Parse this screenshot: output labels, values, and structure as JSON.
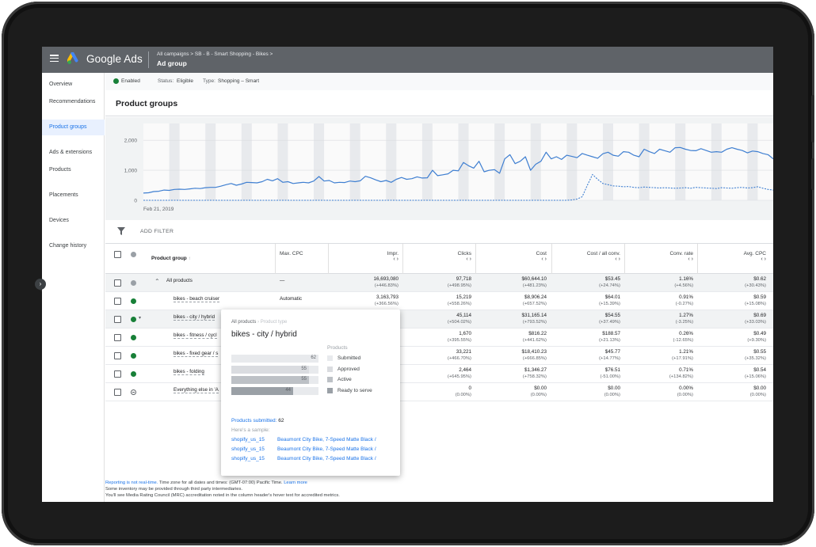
{
  "app": {
    "brand": "Google Ads"
  },
  "breadcrumb": {
    "path": "All campaigns  >  SB - B - Smart Shopping - Bikes  >",
    "title": "Ad group"
  },
  "sidebar": {
    "items": [
      {
        "label": "Overview"
      },
      {
        "label": "Recommendations"
      },
      {
        "label": "Product groups",
        "active": true
      },
      {
        "label": "Ads & extensions"
      },
      {
        "label": "Products"
      },
      {
        "label": "Placements"
      },
      {
        "label": "Devices"
      },
      {
        "label": "Change history"
      }
    ]
  },
  "status": {
    "state": "Enabled",
    "status_label": "Status:",
    "status_value": "Eligible",
    "type_label": "Type:",
    "type_value": "Shopping – Smart"
  },
  "page": {
    "title": "Product groups"
  },
  "chart_data": {
    "type": "line",
    "x_start_label": "Feb 21, 2019",
    "yticks": [
      "2,000",
      "1,000",
      "0"
    ],
    "ylim": [
      0,
      2400
    ],
    "grid": true,
    "series": [
      {
        "values": [
          240,
          250,
          290,
          300,
          340,
          330,
          360,
          370,
          360,
          380,
          400,
          390,
          420,
          430,
          430,
          470,
          520,
          560,
          500,
          540,
          600,
          590,
          580,
          620,
          700,
          650,
          720,
          600,
          620,
          560,
          580,
          600,
          580,
          640,
          790,
          640,
          660,
          580,
          600,
          590,
          640,
          620,
          650,
          800,
          750,
          680,
          620,
          660,
          600,
          700,
          760,
          700,
          720,
          780,
          740,
          750,
          1000,
          820,
          850,
          880,
          1000,
          980,
          1260,
          1150,
          1070,
          1300,
          950,
          1000,
          1020,
          900,
          1380,
          1520,
          1220,
          1300,
          1450,
          1000,
          1200,
          1300,
          1600,
          1380,
          1450,
          1360,
          1500,
          1460,
          1420,
          1560,
          1500,
          1450,
          1400,
          1550,
          1600,
          1500,
          1470,
          1620,
          1600,
          1500,
          1450,
          1700,
          1620,
          1560,
          1700,
          1650,
          1600,
          1750,
          1760,
          1700,
          1660,
          1650,
          1720,
          1660,
          1600,
          1620,
          1600,
          1700,
          1750,
          1700,
          1660,
          1580,
          1640,
          1620,
          1560,
          1520,
          1380
        ]
      },
      {
        "values": [
          0,
          0,
          0,
          0,
          0,
          0,
          0,
          0,
          0,
          0,
          0,
          0,
          0,
          0,
          0,
          0,
          0,
          0,
          0,
          0,
          0,
          0,
          0,
          0,
          0,
          0,
          0,
          0,
          0,
          0,
          0,
          0,
          0,
          0,
          0,
          0,
          0,
          0,
          0,
          0,
          0,
          0,
          0,
          0,
          0,
          0,
          0,
          0,
          0,
          0,
          0,
          0,
          0,
          0,
          0,
          0,
          0,
          0,
          0,
          0,
          0,
          0,
          0,
          0,
          0,
          0,
          0,
          0,
          0,
          0,
          0,
          0,
          0,
          0,
          0,
          0,
          0,
          0,
          0,
          0,
          0,
          0,
          0,
          10,
          40,
          120,
          500,
          860,
          700,
          560,
          520,
          480,
          470,
          450,
          460,
          430,
          420,
          440,
          430,
          420,
          410,
          420,
          410,
          400,
          410,
          420,
          400,
          430,
          420,
          410,
          400,
          390,
          420,
          410,
          400,
          420,
          430,
          410,
          420,
          450,
          400,
          360,
          340,
          350
        ]
      }
    ]
  },
  "filter": {
    "label": "ADD FILTER"
  },
  "table": {
    "headers": {
      "group": "Product group",
      "cpc": "Max. CPC",
      "impr": "Impr.",
      "clicks": "Clicks",
      "cost": "Cost",
      "cpa": "Cost / all conv.",
      "rate": "Conv. rate",
      "avgcpc": "Avg. CPC"
    },
    "rows": [
      {
        "name": "All products",
        "cpc": "—",
        "impr": "16,693,080",
        "impr_d": "(+446.83%)",
        "clicks": "97,718",
        "clicks_d": "(+498.95%)",
        "cost": "$60,644.10",
        "cost_d": "(+481.23%)",
        "cpa": "$53.45",
        "cpa_d": "(+24.74%)",
        "rate": "1.16%",
        "rate_d": "(+4.56%)",
        "avgcpc": "$0.62",
        "avgcpc_d": "(+30.43%)"
      },
      {
        "name": "bikes - beach cruiser",
        "cpc": "Automatic",
        "impr": "3,163,793",
        "impr_d": "(+366.56%)",
        "clicks": "15,219",
        "clicks_d": "(+558.26%)",
        "cost": "$8,906.24",
        "cost_d": "(+657.52%)",
        "cpa": "$64.01",
        "cpa_d": "(+15.39%)",
        "rate": "0.91%",
        "rate_d": "(-0.27%)",
        "avgcpc": "$0.59",
        "avgcpc_d": "(+15.08%)"
      },
      {
        "name": "bikes - city / hybrid",
        "cpc": "",
        "impr": "",
        "impr_d": "",
        "clicks": "45,114",
        "clicks_d": "(+504.02%)",
        "cost": "$31,165.14",
        "cost_d": "(+793.52%)",
        "cpa": "$54.55",
        "cpa_d": "(+37.49%)",
        "rate": "1.27%",
        "rate_d": "(-3.25%)",
        "avgcpc": "$0.69",
        "avgcpc_d": "(+33.03%)"
      },
      {
        "name": "bikes - fitness / cycl",
        "cpc": "",
        "impr": "",
        "impr_d": "",
        "clicks": "1,670",
        "clicks_d": "(+395.55%)",
        "cost": "$816.22",
        "cost_d": "(+441.62%)",
        "cpa": "$188.57",
        "cpa_d": "(+21.13%)",
        "rate": "0.26%",
        "rate_d": "(-12.65%)",
        "avgcpc": "$0.49",
        "avgcpc_d": "(+9.30%)"
      },
      {
        "name": "bikes - fixed gear / s",
        "cpc": "",
        "impr": "",
        "impr_d": "",
        "clicks": "33,221",
        "clicks_d": "(+466.70%)",
        "cost": "$18,410.23",
        "cost_d": "(+666.85%)",
        "cpa": "$45.77",
        "cpa_d": "(+14.77%)",
        "rate": "1.21%",
        "rate_d": "(+17.91%)",
        "avgcpc": "$0.55",
        "avgcpc_d": "(+35.32%)"
      },
      {
        "name": "bikes - folding",
        "cpc": "",
        "impr": "",
        "impr_d": "",
        "clicks": "2,464",
        "clicks_d": "(+645.95%)",
        "cost": "$1,346.27",
        "cost_d": "(+758.32%)",
        "cpa": "$76.51",
        "cpa_d": "(-51.00%)",
        "rate": "0.71%",
        "rate_d": "(+134.82%)",
        "avgcpc": "$0.54",
        "avgcpc_d": "(+15.06%)"
      },
      {
        "name": "Everything else in 'A",
        "cpc": "",
        "impr": "",
        "impr_d": "",
        "clicks": "0",
        "clicks_d": "(0.00%)",
        "cost": "$0.00",
        "cost_d": "(0.00%)",
        "cpa": "$0.00",
        "cpa_d": "(0.00%)",
        "rate": "0.00%",
        "rate_d": "(0.00%)",
        "avgcpc": "$0.00",
        "avgcpc_d": "(0.00%)"
      }
    ]
  },
  "popup": {
    "crumb_a": "All products",
    "crumb_b": " › Product type",
    "title": "bikes - city / hybrid",
    "legend_title": "Products",
    "bars": [
      {
        "label": "Submitted",
        "value": 62,
        "color": "#e8eaed"
      },
      {
        "label": "Approved",
        "value": 55,
        "color": "#dadce0"
      },
      {
        "label": "Active",
        "value": 55,
        "color": "#bdc1c6"
      },
      {
        "label": "Ready to serve",
        "value": 44,
        "color": "#9aa0a6"
      }
    ],
    "submitted_label": "Products submitted:",
    "submitted_value": "62",
    "sample_label": "Here's a sample:",
    "samples": [
      {
        "id": "shopify_us_15",
        "title": "Beaumont City Bike, 7-Speed Matte Black /"
      },
      {
        "id": "shopify_us_15",
        "title": "Beaumont City Bike, 7-Speed Matte Black /"
      },
      {
        "id": "shopify_us_15",
        "title": "Beaumont City Bike, 7-Speed Matte Black /"
      }
    ]
  },
  "footer": {
    "lead": "Reporting is not real-time.",
    "line1": " Time zone for all dates and times: (GMT-07:00) Pacific Time.",
    "learn": " Learn more",
    "line2": "Some inventory may be provided through third party intermediaries.",
    "line3": "You'll see Media Rating Council (MRC) accreditation noted in the column header's hover text for accredited metrics."
  },
  "colors": {
    "accent": "#1a73e8",
    "enabled": "#188038",
    "topbar": "#5f6368"
  }
}
